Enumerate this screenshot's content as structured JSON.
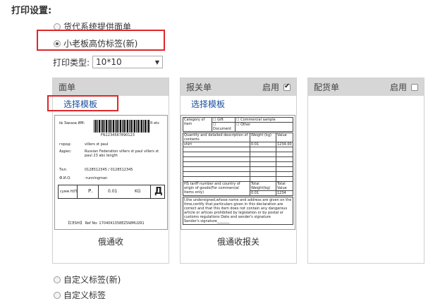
{
  "section_title": "打印设置:",
  "options": [
    {
      "label": "货代系统提供面单",
      "checked": false
    },
    {
      "label": "小老板高仿标签(新)",
      "checked": true
    },
    {
      "label": "自定义标签(新)",
      "checked": false
    },
    {
      "label": "自定义标签",
      "checked": false
    }
  ],
  "print_type": {
    "label": "打印类型:",
    "value": "10*10"
  },
  "panels": {
    "label": {
      "header": "面单",
      "select_link": "选择模板",
      "caption": "俄通收"
    },
    "customs": {
      "header": "报关单",
      "enable_label": "启用",
      "enabled": true,
      "select_link": "选择模板",
      "caption": "俄通收报关"
    },
    "picking": {
      "header": "配货单",
      "enable_label": "启用",
      "enabled": false
    }
  },
  "label_thumb": {
    "order_no_label": "№ Заказа ИМ:",
    "tracking": "FN1234567890123",
    "r_ets": "R ets",
    "city_label": "город:",
    "city_value": "villers st paul",
    "address_label": "Адрес:",
    "address_value": "Russian Federation villers st paul villers st paul 23 abc length",
    "phone_label": "Тел:",
    "phone_value": "0128512345 / 0128512345",
    "name_label": "Ф.И.О.",
    "name_value": "-runningman",
    "sum_label": "сумм Н/П",
    "rub": "Р.",
    "weight": "0.01",
    "kg": "KG",
    "d_mark": "Д",
    "ref": "【CESHI】  Ref No: 1704041358EZSWMU2R1"
  },
  "customs_thumb": {
    "category_label": "Category of item",
    "gift": "Gift",
    "commercial_sample": "Commercial sample",
    "document": "Document",
    "other": "Other",
    "qty_desc": "Quantity and detailed description of contents",
    "weight_kg": "Weight (kg)",
    "value": "Value",
    "row_item": "shirt",
    "row_weight": "0.01",
    "row_value": "1234.00",
    "hs_label": "HS tariff number and country of origin of goods(For commercial items only)",
    "total_weight": "Total Weight(kg)",
    "total_value": "Total Value",
    "tw_val": "0.01",
    "tv_val": "1234",
    "declaration": "I,the undersigned,whose name and address are given on the itme,certify that particulars given in this declaration are correct and that this item does not contain any dangerous article or artices prohibited by legislation or by postal or customs regulations Date and sender's signature",
    "signature": "Sender's signature_______"
  }
}
